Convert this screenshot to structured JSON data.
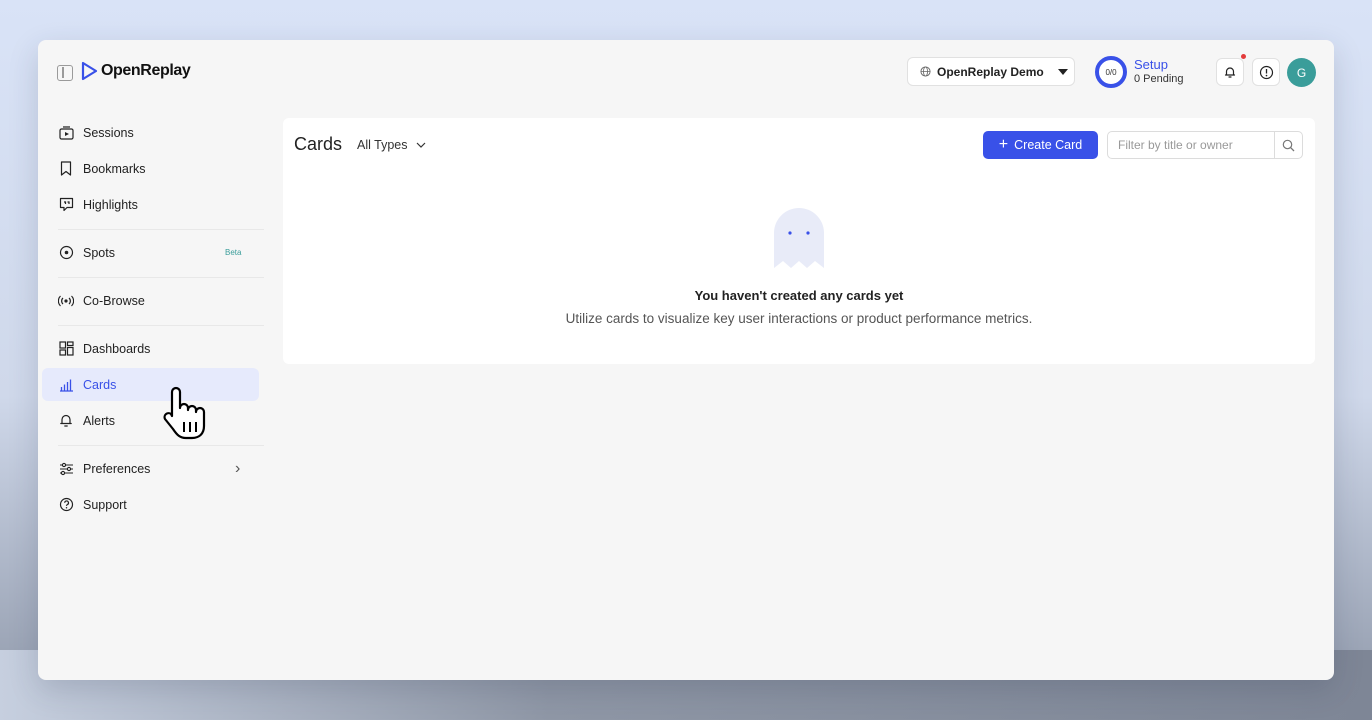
{
  "header": {
    "logo_text": "OpenReplay",
    "project": "OpenReplay Demo",
    "setup_progress": "0/0",
    "setup_title": "Setup",
    "setup_sub": "0 Pending",
    "avatar_initial": "G"
  },
  "sidebar": {
    "items": [
      {
        "label": "Sessions",
        "icon": "sessions-icon"
      },
      {
        "label": "Bookmarks",
        "icon": "bookmark-icon"
      },
      {
        "label": "Highlights",
        "icon": "highlights-icon"
      },
      {
        "label": "Spots",
        "icon": "spots-icon",
        "badge": "Beta"
      },
      {
        "label": "Co-Browse",
        "icon": "cobrowse-icon"
      },
      {
        "label": "Dashboards",
        "icon": "dashboards-icon"
      },
      {
        "label": "Cards",
        "icon": "cards-icon",
        "active": true
      },
      {
        "label": "Alerts",
        "icon": "bell-icon"
      },
      {
        "label": "Preferences",
        "icon": "sliders-icon"
      },
      {
        "label": "Support",
        "icon": "help-icon"
      }
    ]
  },
  "main": {
    "title": "Cards",
    "type_filter": "All Types",
    "create_button": "Create Card",
    "search_placeholder": "Filter by title or owner",
    "empty_title": "You haven't created any cards yet",
    "empty_subtitle": "Utilize cards to visualize key user interactions or product performance metrics."
  },
  "colors": {
    "accent": "#3951e8",
    "active_bg": "#e6eafc",
    "avatar": "#3a9d9a",
    "notification": "#e33b3b"
  }
}
